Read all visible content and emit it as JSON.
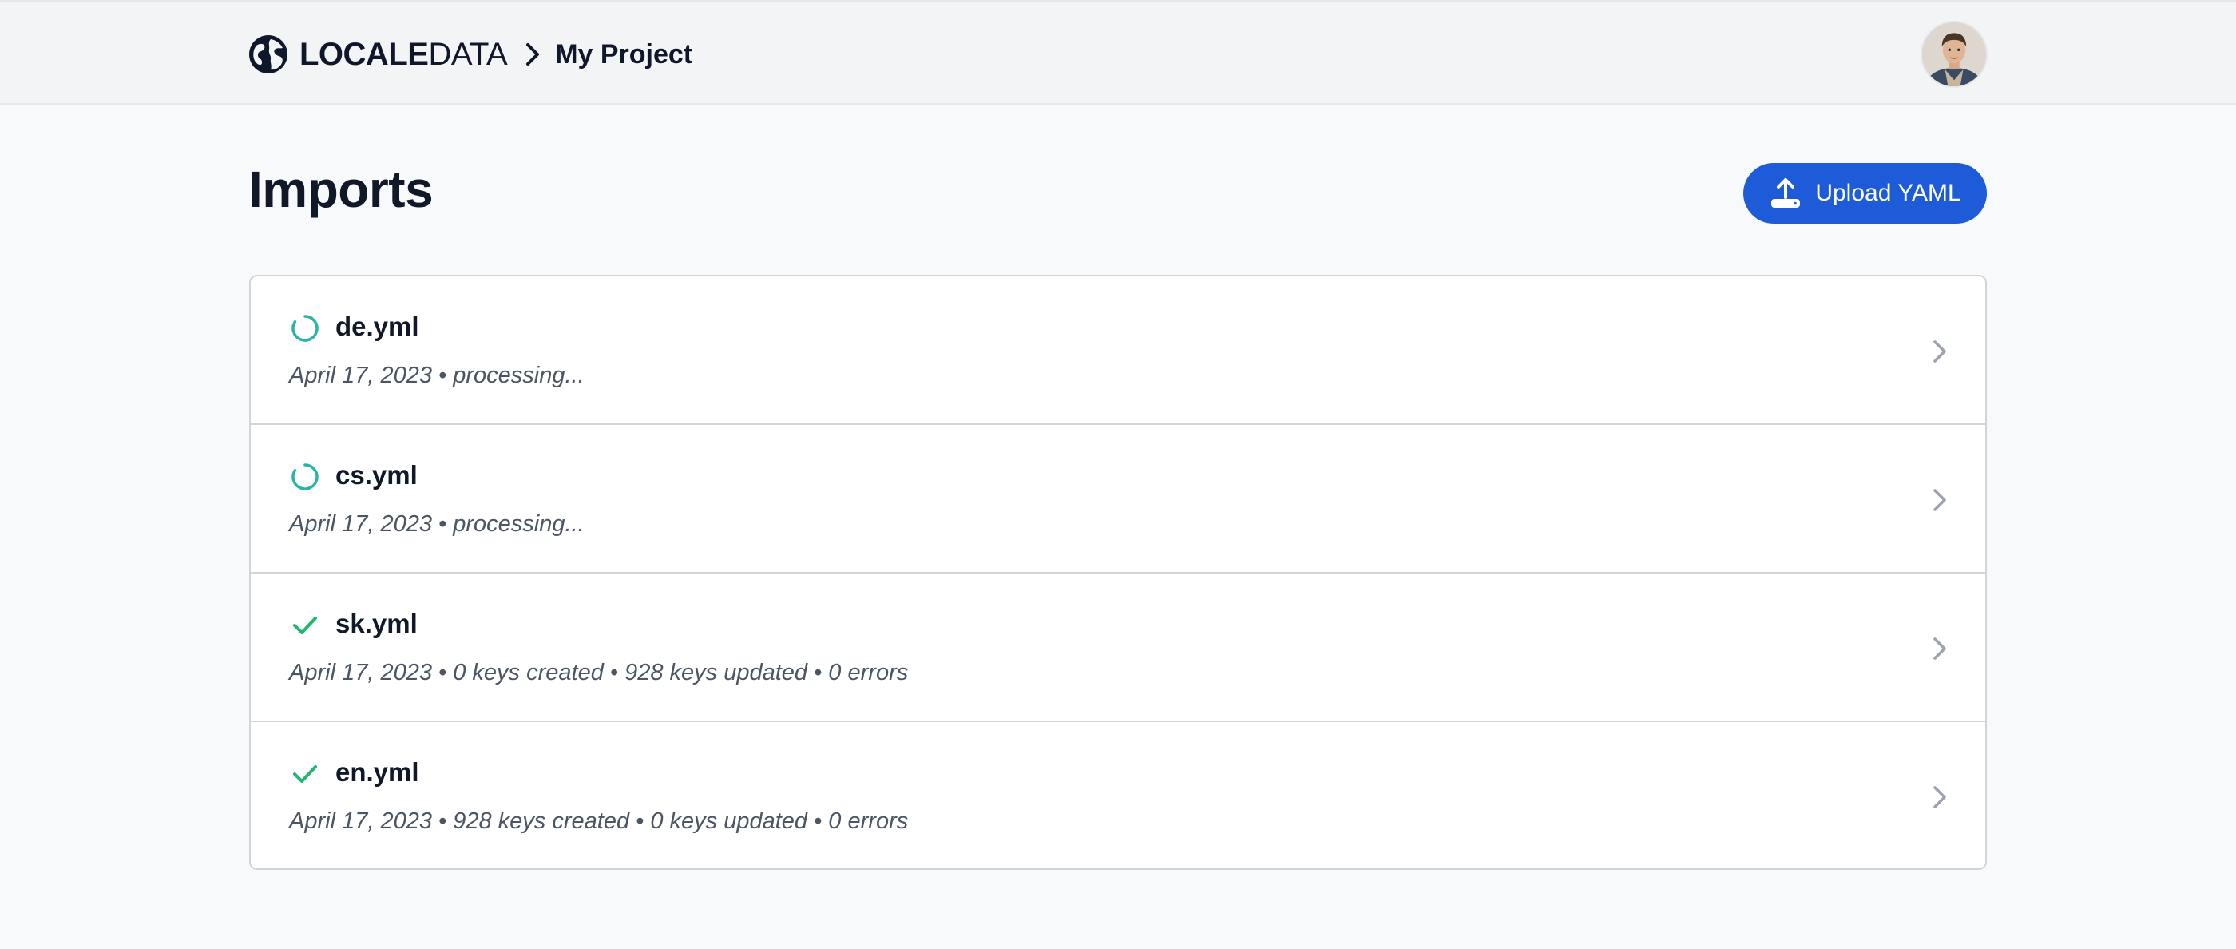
{
  "header": {
    "logo_bold": "LOCALE",
    "logo_light": "DATA",
    "project_name": "My Project",
    "avatar_alt": "User avatar"
  },
  "page": {
    "title": "Imports",
    "upload_label": "Upload YAML"
  },
  "colors": {
    "accent": "#1d5bd8",
    "processing": "#2bb3a3",
    "success": "#22b573"
  },
  "imports": [
    {
      "file": "de.yml",
      "status": "processing",
      "status_icon": "spinner-icon",
      "meta": "April 17, 2023 • processing..."
    },
    {
      "file": "cs.yml",
      "status": "processing",
      "status_icon": "spinner-icon",
      "meta": "April 17, 2023 • processing..."
    },
    {
      "file": "sk.yml",
      "status": "done",
      "status_icon": "check-icon",
      "meta": "April 17, 2023 • 0 keys created • 928 keys updated • 0 errors"
    },
    {
      "file": "en.yml",
      "status": "done",
      "status_icon": "check-icon",
      "meta": "April 17, 2023 • 928 keys created • 0 keys updated • 0 errors"
    }
  ]
}
